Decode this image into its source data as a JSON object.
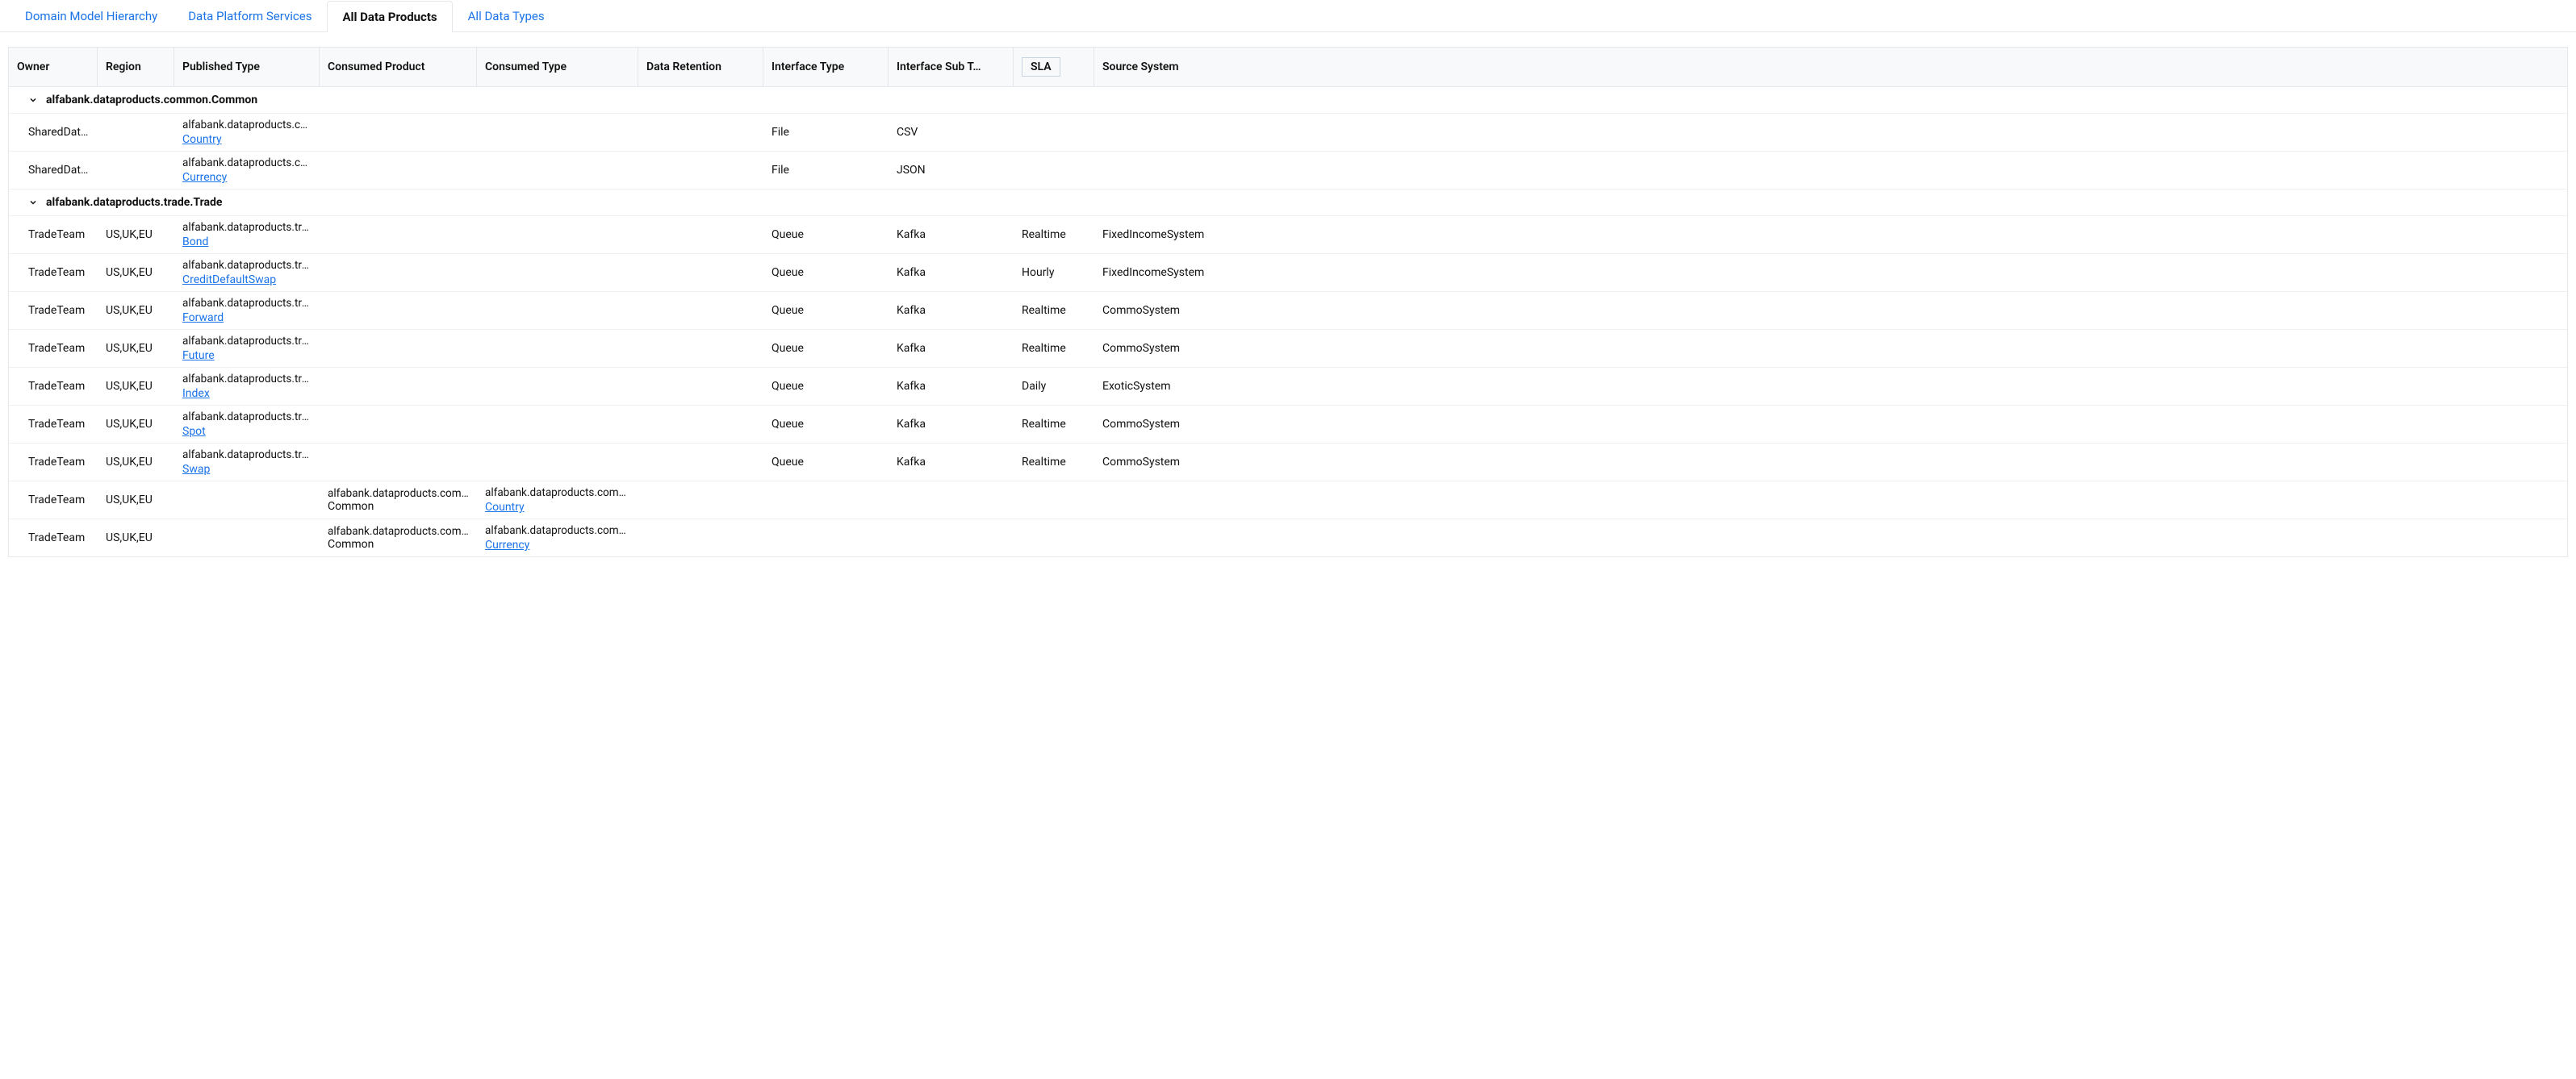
{
  "tabs": [
    {
      "label": "Domain Model Hierarchy",
      "active": false
    },
    {
      "label": "Data Platform Services",
      "active": false
    },
    {
      "label": "All Data Products",
      "active": true
    },
    {
      "label": "All Data Types",
      "active": false
    }
  ],
  "columns": [
    {
      "label": "Owner"
    },
    {
      "label": "Region"
    },
    {
      "label": "Published Type"
    },
    {
      "label": "Consumed Product"
    },
    {
      "label": "Consumed Type"
    },
    {
      "label": "Data Retention"
    },
    {
      "label": "Interface Type"
    },
    {
      "label": "Interface Sub T…"
    },
    {
      "label": "SLA",
      "sorted": true
    },
    {
      "label": "Source System"
    }
  ],
  "groups": [
    {
      "title": "alfabank.dataproducts.common.Common",
      "rows": [
        {
          "owner": "SharedData…",
          "region": "",
          "pub_pkg": "alfabank.dataproducts.co…",
          "pub_link": "Country",
          "con_prod_pkg": "",
          "con_prod_txt": "",
          "con_type_pkg": "",
          "con_type_link": "",
          "retention": "",
          "iface_type": "File",
          "iface_sub": "CSV",
          "sla": "",
          "source": ""
        },
        {
          "owner": "SharedData…",
          "region": "",
          "pub_pkg": "alfabank.dataproducts.co…",
          "pub_link": "Currency",
          "con_prod_pkg": "",
          "con_prod_txt": "",
          "con_type_pkg": "",
          "con_type_link": "",
          "retention": "",
          "iface_type": "File",
          "iface_sub": "JSON",
          "sla": "",
          "source": ""
        }
      ]
    },
    {
      "title": "alfabank.dataproducts.trade.Trade",
      "rows": [
        {
          "owner": "TradeTeam",
          "region": "US,UK,EU",
          "pub_pkg": "alfabank.dataproducts.trade",
          "pub_link": "Bond",
          "con_prod_pkg": "",
          "con_prod_txt": "",
          "con_type_pkg": "",
          "con_type_link": "",
          "retention": "",
          "iface_type": "Queue",
          "iface_sub": "Kafka",
          "sla": "Realtime",
          "source": "FixedIncomeSystem"
        },
        {
          "owner": "TradeTeam",
          "region": "US,UK,EU",
          "pub_pkg": "alfabank.dataproducts.trade",
          "pub_link": "CreditDefaultSwap",
          "con_prod_pkg": "",
          "con_prod_txt": "",
          "con_type_pkg": "",
          "con_type_link": "",
          "retention": "",
          "iface_type": "Queue",
          "iface_sub": "Kafka",
          "sla": "Hourly",
          "source": "FixedIncomeSystem"
        },
        {
          "owner": "TradeTeam",
          "region": "US,UK,EU",
          "pub_pkg": "alfabank.dataproducts.trade",
          "pub_link": "Forward",
          "con_prod_pkg": "",
          "con_prod_txt": "",
          "con_type_pkg": "",
          "con_type_link": "",
          "retention": "",
          "iface_type": "Queue",
          "iface_sub": "Kafka",
          "sla": "Realtime",
          "source": "CommoSystem"
        },
        {
          "owner": "TradeTeam",
          "region": "US,UK,EU",
          "pub_pkg": "alfabank.dataproducts.trade",
          "pub_link": "Future",
          "con_prod_pkg": "",
          "con_prod_txt": "",
          "con_type_pkg": "",
          "con_type_link": "",
          "retention": "",
          "iface_type": "Queue",
          "iface_sub": "Kafka",
          "sla": "Realtime",
          "source": "CommoSystem"
        },
        {
          "owner": "TradeTeam",
          "region": "US,UK,EU",
          "pub_pkg": "alfabank.dataproducts.trade",
          "pub_link": "Index",
          "con_prod_pkg": "",
          "con_prod_txt": "",
          "con_type_pkg": "",
          "con_type_link": "",
          "retention": "",
          "iface_type": "Queue",
          "iface_sub": "Kafka",
          "sla": "Daily",
          "source": "ExoticSystem"
        },
        {
          "owner": "TradeTeam",
          "region": "US,UK,EU",
          "pub_pkg": "alfabank.dataproducts.trade",
          "pub_link": "Spot",
          "con_prod_pkg": "",
          "con_prod_txt": "",
          "con_type_pkg": "",
          "con_type_link": "",
          "retention": "",
          "iface_type": "Queue",
          "iface_sub": "Kafka",
          "sla": "Realtime",
          "source": "CommoSystem"
        },
        {
          "owner": "TradeTeam",
          "region": "US,UK,EU",
          "pub_pkg": "alfabank.dataproducts.trade",
          "pub_link": "Swap",
          "con_prod_pkg": "",
          "con_prod_txt": "",
          "con_type_pkg": "",
          "con_type_link": "",
          "retention": "",
          "iface_type": "Queue",
          "iface_sub": "Kafka",
          "sla": "Realtime",
          "source": "CommoSystem"
        },
        {
          "owner": "TradeTeam",
          "region": "US,UK,EU",
          "pub_pkg": "",
          "pub_link": "",
          "con_prod_pkg": "alfabank.dataproducts.common",
          "con_prod_txt": "Common",
          "con_type_pkg": "alfabank.dataproducts.common",
          "con_type_link": "Country",
          "retention": "",
          "iface_type": "",
          "iface_sub": "",
          "sla": "",
          "source": ""
        },
        {
          "owner": "TradeTeam",
          "region": "US,UK,EU",
          "pub_pkg": "",
          "pub_link": "",
          "con_prod_pkg": "alfabank.dataproducts.common",
          "con_prod_txt": "Common",
          "con_type_pkg": "alfabank.dataproducts.common",
          "con_type_link": "Currency",
          "retention": "",
          "iface_type": "",
          "iface_sub": "",
          "sla": "",
          "source": ""
        }
      ]
    }
  ]
}
